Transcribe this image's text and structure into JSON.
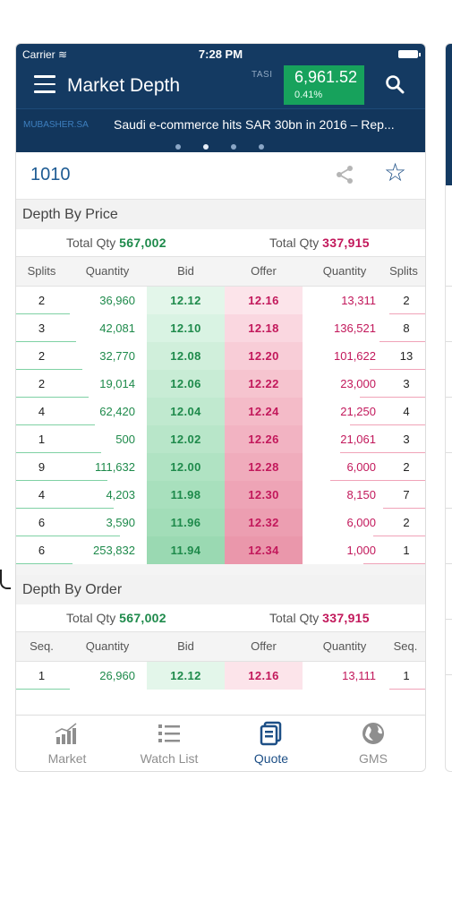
{
  "status": {
    "carrier": "Carrier",
    "time": "7:28 PM"
  },
  "navbar": {
    "title": "Market Depth",
    "index_label": "TASI",
    "index_value": "6,961.52",
    "index_change": "0.41%"
  },
  "ticker": {
    "source": "MUBASHER.SA",
    "headline": "Saudi e-commerce hits SAR 30bn in 2016 – Rep..."
  },
  "symbol": {
    "code": "1010"
  },
  "depth_by_price": {
    "title": "Depth By Price",
    "total_bid_label": "Total Qty",
    "total_bid_value": "567,002",
    "total_offer_label": "Total Qty",
    "total_offer_value": "337,915",
    "columns": [
      "Splits",
      "Quantity",
      "Bid",
      "Offer",
      "Quantity",
      "Splits"
    ],
    "rows": [
      {
        "bid_splits": "2",
        "bid_qty": "36,960",
        "bid": "12.12",
        "offer": "12.16",
        "offer_qty": "13,311",
        "offer_splits": "2"
      },
      {
        "bid_splits": "3",
        "bid_qty": "42,081",
        "bid": "12.10",
        "offer": "12.18",
        "offer_qty": "136,521",
        "offer_splits": "8"
      },
      {
        "bid_splits": "2",
        "bid_qty": "32,770",
        "bid": "12.08",
        "offer": "12.20",
        "offer_qty": "101,622",
        "offer_splits": "13"
      },
      {
        "bid_splits": "2",
        "bid_qty": "19,014",
        "bid": "12.06",
        "offer": "12.22",
        "offer_qty": "23,000",
        "offer_splits": "3"
      },
      {
        "bid_splits": "4",
        "bid_qty": "62,420",
        "bid": "12.04",
        "offer": "12.24",
        "offer_qty": "21,250",
        "offer_splits": "4"
      },
      {
        "bid_splits": "1",
        "bid_qty": "500",
        "bid": "12.02",
        "offer": "12.26",
        "offer_qty": "21,061",
        "offer_splits": "3"
      },
      {
        "bid_splits": "9",
        "bid_qty": "111,632",
        "bid": "12.00",
        "offer": "12.28",
        "offer_qty": "6,000",
        "offer_splits": "2"
      },
      {
        "bid_splits": "4",
        "bid_qty": "4,203",
        "bid": "11.98",
        "offer": "12.30",
        "offer_qty": "8,150",
        "offer_splits": "7"
      },
      {
        "bid_splits": "6",
        "bid_qty": "3,590",
        "bid": "11.96",
        "offer": "12.32",
        "offer_qty": "6,000",
        "offer_splits": "2"
      },
      {
        "bid_splits": "6",
        "bid_qty": "253,832",
        "bid": "11.94",
        "offer": "12.34",
        "offer_qty": "1,000",
        "offer_splits": "1"
      }
    ]
  },
  "depth_by_order": {
    "title": "Depth By Order",
    "total_bid_label": "Total Qty",
    "total_bid_value": "567,002",
    "total_offer_label": "Total Qty",
    "total_offer_value": "337,915",
    "columns": [
      "Seq.",
      "Quantity",
      "Bid",
      "Offer",
      "Quantity",
      "Seq."
    ],
    "rows": [
      {
        "seq": "1",
        "bid_qty": "26,960",
        "bid": "12.12",
        "offer": "12.16",
        "offer_qty": "13,111",
        "seq2": "1"
      }
    ]
  },
  "tabs": [
    {
      "label": "Market",
      "icon": "market-chart-icon",
      "active": false
    },
    {
      "label": "Watch List",
      "icon": "list-icon",
      "active": false
    },
    {
      "label": "Quote",
      "icon": "quote-icon",
      "active": true
    },
    {
      "label": "GMS",
      "icon": "globe-icon",
      "active": false
    }
  ],
  "colors": {
    "header": "#143a62",
    "index_up": "#17a25c",
    "bid": "#1e8a4b",
    "offer": "#c2185b",
    "accent": "#1d4f86"
  }
}
